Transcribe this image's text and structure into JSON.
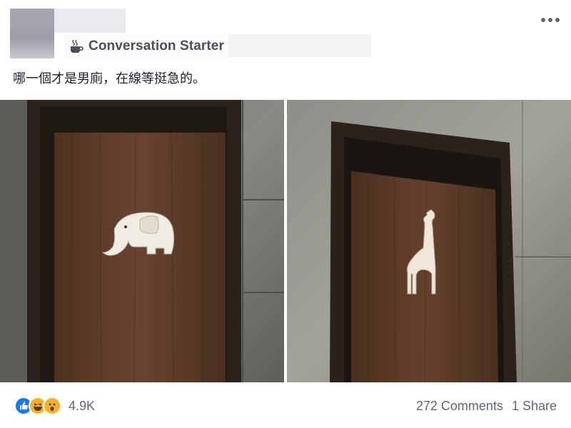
{
  "post": {
    "page_name": "Conversation Starter",
    "separator": "·",
    "caption": "哪一個才是男廁，在線等挺急的。",
    "icons": {
      "page_badge": "coffee-cup-icon",
      "menu": "more-options-icon",
      "reactions": [
        "like-icon",
        "haha-icon",
        "wow-icon"
      ]
    }
  },
  "footer": {
    "reaction_count": "4.9K",
    "comments": "272 Comments",
    "shares": "1 Share"
  },
  "colors": {
    "like_blue": "#1877f2",
    "reaction_yellow": "#f7b125",
    "door_wood": "#5a3a24",
    "frame_dark": "#2a221d"
  }
}
